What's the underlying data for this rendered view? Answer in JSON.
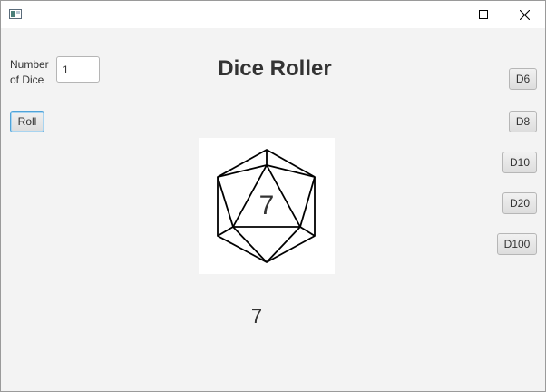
{
  "window": {
    "controls": [
      "minimize-icon",
      "maximize-icon",
      "close-icon"
    ]
  },
  "controls": {
    "number_label_line1": "Number",
    "number_label_line2": "of Dice",
    "number_value": "1",
    "roll_label": "Roll"
  },
  "title": "Dice Roller",
  "die": {
    "shape": "d20-icosahedron-icon",
    "face_value": "7"
  },
  "result": "7",
  "dice_buttons": {
    "d6": "D6",
    "d8": "D8",
    "d10": "D10",
    "d20": "D20",
    "d100": "D100"
  },
  "colors": {
    "focus_border": "#4fa3d9",
    "background": "#f3f3f3"
  }
}
